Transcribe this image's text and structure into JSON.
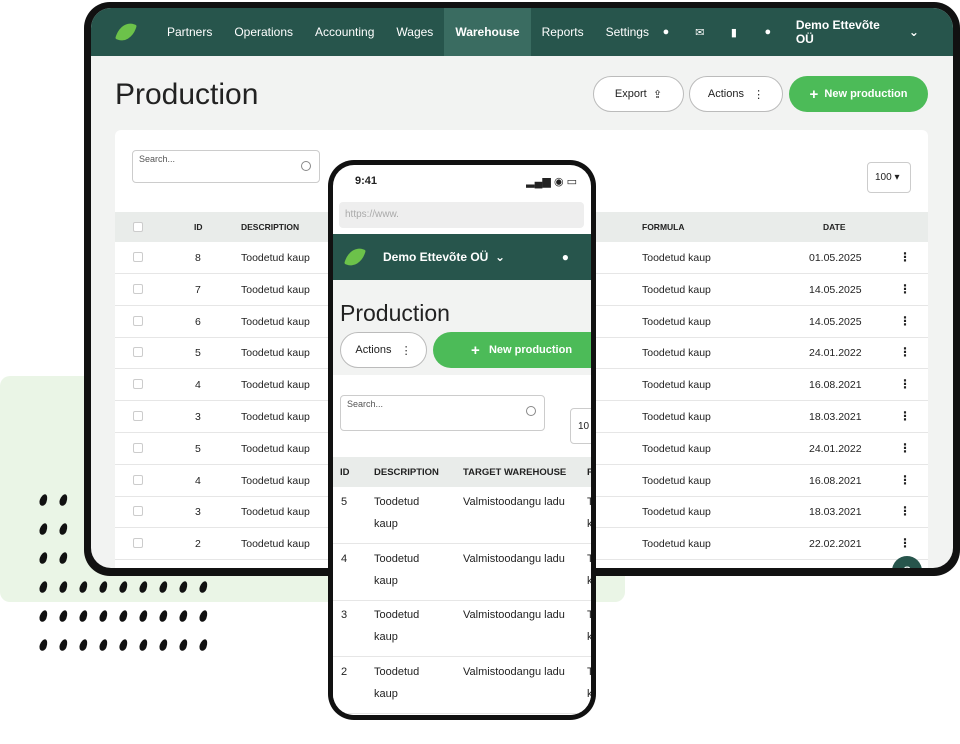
{
  "desktop": {
    "nav": [
      "Partners",
      "Operations",
      "Accounting",
      "Wages",
      "Warehouse",
      "Reports",
      "Settings"
    ],
    "company": "Demo Ettevõte OÜ",
    "title": "Production",
    "export_label": "Export",
    "actions_label": "Actions",
    "new_label": "New production",
    "search_placeholder": "Search...",
    "page_size": "100",
    "columns": {
      "id": "ID",
      "description": "DESCRIPTION",
      "formula": "FORMULA",
      "date": "DATE"
    },
    "rows": [
      {
        "id": "8",
        "description": "Toodetud kaup",
        "formula": "Toodetud kaup",
        "date": "01.05.2025"
      },
      {
        "id": "7",
        "description": "Toodetud kaup",
        "formula": "Toodetud kaup",
        "date": "14.05.2025"
      },
      {
        "id": "6",
        "description": "Toodetud kaup",
        "formula": "Toodetud kaup",
        "date": "14.05.2025"
      },
      {
        "id": "5",
        "description": "Toodetud kaup",
        "formula": "Toodetud kaup",
        "date": "24.01.2022"
      },
      {
        "id": "4",
        "description": "Toodetud kaup",
        "formula": "Toodetud kaup",
        "date": "16.08.2021"
      },
      {
        "id": "3",
        "description": "Toodetud kaup",
        "formula": "Toodetud kaup",
        "date": "18.03.2021"
      },
      {
        "id": "5",
        "description": "Toodetud kaup",
        "formula": "Toodetud kaup",
        "date": "24.01.2022"
      },
      {
        "id": "4",
        "description": "Toodetud kaup",
        "formula": "Toodetud kaup",
        "date": "16.08.2021"
      },
      {
        "id": "3",
        "description": "Toodetud kaup",
        "formula": "Toodetud kaup",
        "date": "18.03.2021"
      },
      {
        "id": "2",
        "description": "Toodetud kaup",
        "formula": "Toodetud kaup",
        "date": "22.02.2021"
      }
    ],
    "help": "?"
  },
  "mobile": {
    "time": "9:41",
    "url": "https://www.",
    "company": "Demo Ettevõte OÜ",
    "title": "Production",
    "actions_label": "Actions",
    "new_label": "New production",
    "search_placeholder": "Search...",
    "page_size": "10",
    "columns": {
      "id": "ID",
      "description": "DESCRIPTION",
      "target": "TARGET WAREHOUSE",
      "f": "F"
    },
    "rows": [
      {
        "id": "5",
        "d1": "Toodetud",
        "d2": "kaup",
        "target": "Valmistoodangu ladu",
        "f1": "T",
        "f2": "k"
      },
      {
        "id": "4",
        "d1": "Toodetud",
        "d2": "kaup",
        "target": "Valmistoodangu ladu",
        "f1": "T",
        "f2": "k"
      },
      {
        "id": "3",
        "d1": "Toodetud",
        "d2": "kaup",
        "target": "Valmistoodangu ladu",
        "f1": "T",
        "f2": "k"
      },
      {
        "id": "2",
        "d1": "Toodetud",
        "d2": "kaup",
        "target": "Valmistoodangu ladu",
        "f1": "T",
        "f2": "k"
      }
    ]
  },
  "colors": {
    "nav_green": "#27554c",
    "accent_green": "#4cbb58",
    "leaf_green": "#6cc24a"
  }
}
